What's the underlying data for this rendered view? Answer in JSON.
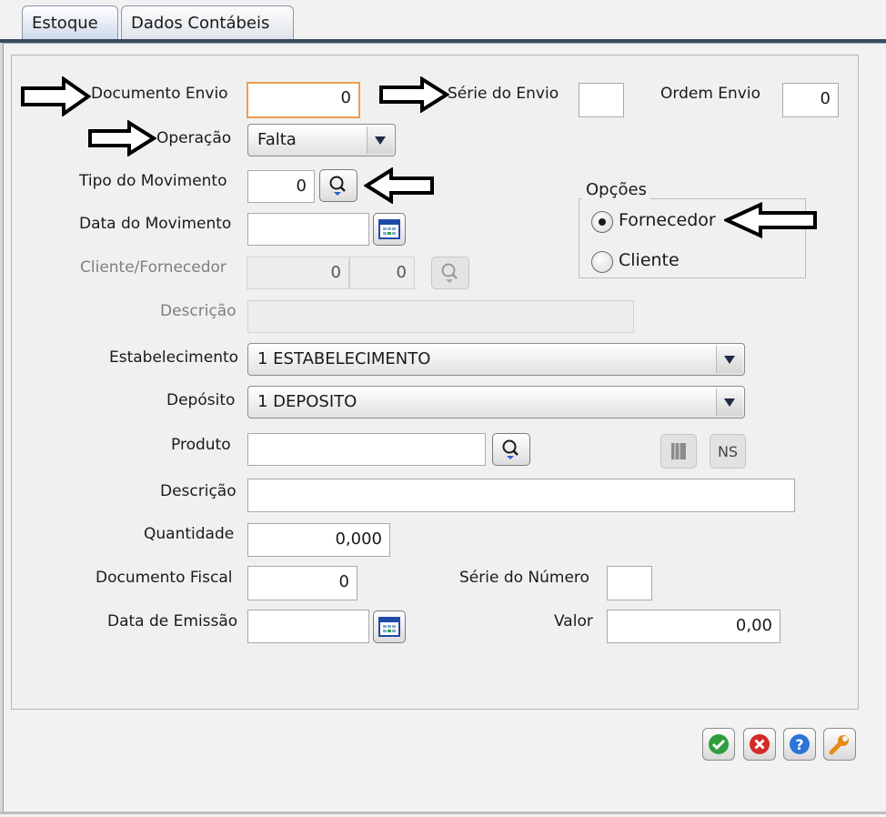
{
  "tabs": [
    {
      "label": "Estoque",
      "active": true
    },
    {
      "label": "Dados Contábeis",
      "active": false
    }
  ],
  "form": {
    "documento_envio": {
      "label": "Documento Envio",
      "value": "0"
    },
    "serie_envio": {
      "label": "Série do Envio",
      "value": ""
    },
    "ordem_envio": {
      "label": "Ordem Envio",
      "value": "0"
    },
    "operacao": {
      "label": "Operação",
      "value": "Falta"
    },
    "tipo_movimento": {
      "label": "Tipo do Movimento",
      "value": "0"
    },
    "data_movimento": {
      "label": "Data do Movimento",
      "value": ""
    },
    "cliente_fornecedor": {
      "label": "Cliente/Fornecedor",
      "value1": "0",
      "value2": "0"
    },
    "descricao_cliente": {
      "label": "Descrição",
      "value": ""
    },
    "estabelecimento": {
      "label": "Estabelecimento",
      "value": "1 ESTABELECIMENTO"
    },
    "deposito": {
      "label": "Depósito",
      "value": "1 DEPOSITO"
    },
    "produto": {
      "label": "Produto",
      "value": ""
    },
    "descricao_produto": {
      "label": "Descrição",
      "value": ""
    },
    "quantidade": {
      "label": "Quantidade",
      "value": "0,000"
    },
    "documento_fiscal": {
      "label": "Documento Fiscal",
      "value": "0"
    },
    "serie_numero": {
      "label": "Série do Número",
      "value": ""
    },
    "data_emissao": {
      "label": "Data de Emissão",
      "value": ""
    },
    "valor": {
      "label": "Valor",
      "value": "0,00"
    },
    "ns_button": "NS"
  },
  "opcoes": {
    "title": "Opções",
    "options": [
      {
        "label": "Fornecedor",
        "selected": true
      },
      {
        "label": "Cliente",
        "selected": false
      }
    ]
  },
  "actions": {
    "confirm_color": "#2e9e3e",
    "cancel_color": "#d42a2a",
    "help_color": "#2b74d8",
    "tools_color": "#e88a1a"
  },
  "icons": [
    "search-icon",
    "calendar-icon",
    "dropdown-arrow-icon",
    "check-icon",
    "close-icon",
    "help-icon",
    "wrench-icon",
    "book-icon",
    "annotation-arrow-icon"
  ]
}
